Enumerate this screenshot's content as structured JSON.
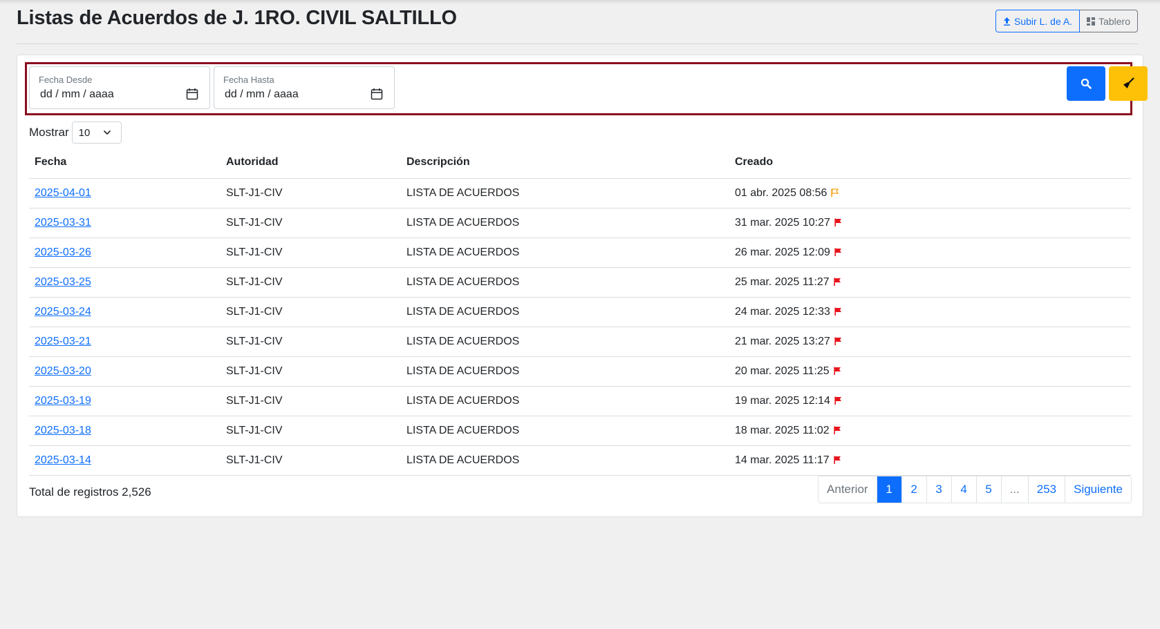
{
  "header": {
    "title": "Listas de Acuerdos de J. 1RO. CIVIL SALTILLO",
    "upload_label": "Subir L. de A.",
    "board_label": "Tablero"
  },
  "filters": {
    "from_label": "Fecha Desde",
    "from_value": "dd / mm / aaaa",
    "to_label": "Fecha Hasta",
    "to_value": "dd / mm / aaaa",
    "search_icon": "search-icon",
    "clear_icon": "broom-icon",
    "frame_color": "#8b0e1f"
  },
  "show": {
    "label": "Mostrar",
    "value": "10"
  },
  "table": {
    "columns": [
      "Fecha",
      "Autoridad",
      "Descripción",
      "Creado"
    ],
    "rows": [
      {
        "fecha": "2025-04-01",
        "autoridad": "SLT-J1-CIV",
        "descripcion": "LISTA DE ACUERDOS",
        "creado": "01 abr. 2025 08:56",
        "flag": "outline"
      },
      {
        "fecha": "2025-03-31",
        "autoridad": "SLT-J1-CIV",
        "descripcion": "LISTA DE ACUERDOS",
        "creado": "31 mar. 2025 10:27",
        "flag": "solid"
      },
      {
        "fecha": "2025-03-26",
        "autoridad": "SLT-J1-CIV",
        "descripcion": "LISTA DE ACUERDOS",
        "creado": "26 mar. 2025 12:09",
        "flag": "solid"
      },
      {
        "fecha": "2025-03-25",
        "autoridad": "SLT-J1-CIV",
        "descripcion": "LISTA DE ACUERDOS",
        "creado": "25 mar. 2025 11:27",
        "flag": "solid"
      },
      {
        "fecha": "2025-03-24",
        "autoridad": "SLT-J1-CIV",
        "descripcion": "LISTA DE ACUERDOS",
        "creado": "24 mar. 2025 12:33",
        "flag": "solid"
      },
      {
        "fecha": "2025-03-21",
        "autoridad": "SLT-J1-CIV",
        "descripcion": "LISTA DE ACUERDOS",
        "creado": "21 mar. 2025 13:27",
        "flag": "solid"
      },
      {
        "fecha": "2025-03-20",
        "autoridad": "SLT-J1-CIV",
        "descripcion": "LISTA DE ACUERDOS",
        "creado": "20 mar. 2025 11:25",
        "flag": "solid"
      },
      {
        "fecha": "2025-03-19",
        "autoridad": "SLT-J1-CIV",
        "descripcion": "LISTA DE ACUERDOS",
        "creado": "19 mar. 2025 12:14",
        "flag": "solid"
      },
      {
        "fecha": "2025-03-18",
        "autoridad": "SLT-J1-CIV",
        "descripcion": "LISTA DE ACUERDOS",
        "creado": "18 mar. 2025 11:02",
        "flag": "solid"
      },
      {
        "fecha": "2025-03-14",
        "autoridad": "SLT-J1-CIV",
        "descripcion": "LISTA DE ACUERDOS",
        "creado": "14 mar. 2025 11:17",
        "flag": "solid"
      }
    ],
    "flag_colors": {
      "solid": "#e8141c",
      "outline": "#f2a20c"
    }
  },
  "footer": {
    "total": "Total de registros 2,526",
    "pagination": {
      "prev": "Anterior",
      "pages": [
        "1",
        "2",
        "3",
        "4",
        "5"
      ],
      "active": "1",
      "ellipsis": "...",
      "last": "253",
      "next": "Siguiente"
    }
  },
  "colors": {
    "primary": "#0d6efd",
    "warning": "#ffc107",
    "page_bg": "#f0f0f0"
  }
}
